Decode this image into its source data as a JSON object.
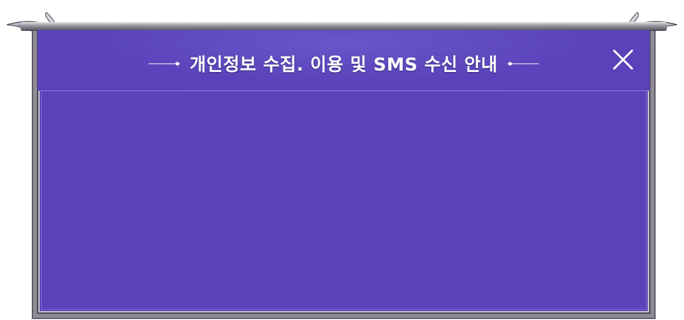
{
  "dialog": {
    "title": "개인정보 수집. 이용 및 SMS 수신 안내",
    "close_icon": "close-icon"
  },
  "colors": {
    "panel": "#5b42bb",
    "frame": "#8e8a96",
    "title_text": "#ffffff"
  }
}
